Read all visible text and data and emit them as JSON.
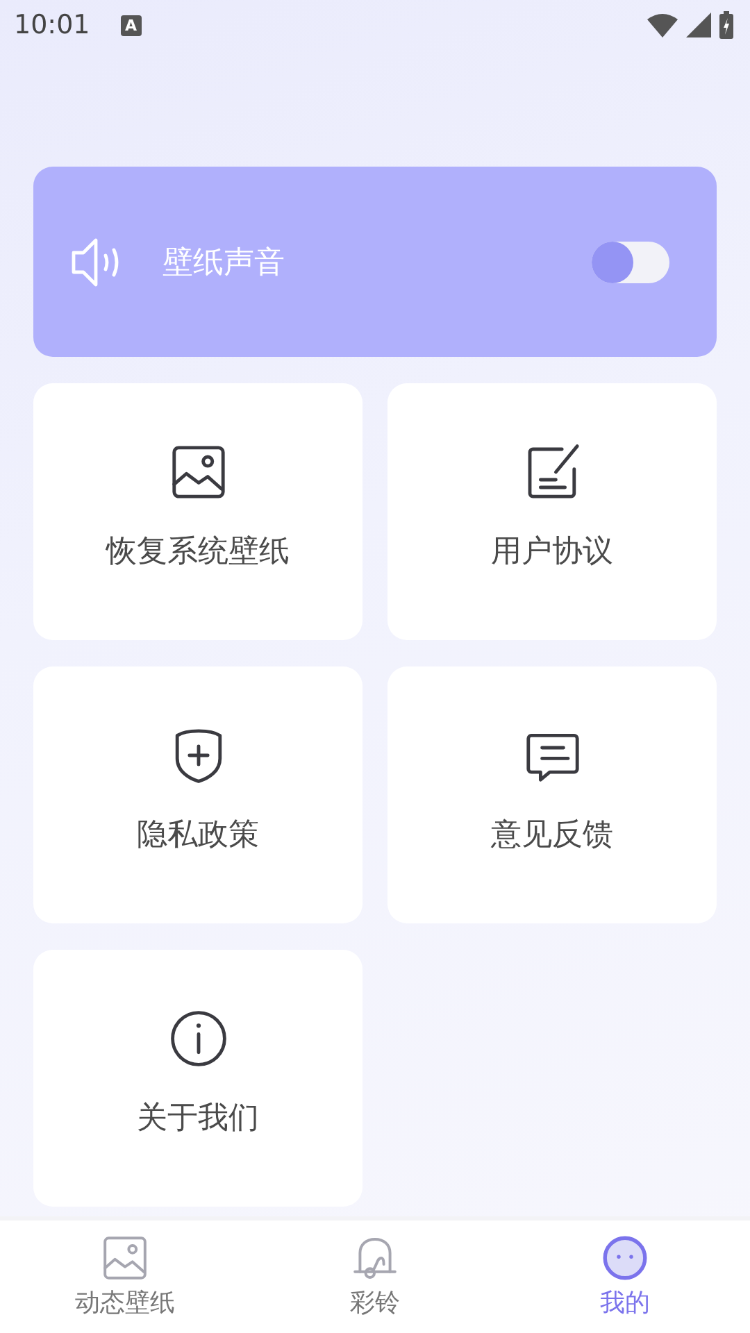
{
  "status_bar": {
    "time": "10:01",
    "app_icon_letter": "A"
  },
  "sound_card": {
    "label": "壁纸声音",
    "on": false
  },
  "menu": [
    {
      "kind": "image",
      "label": "恢复系统壁纸"
    },
    {
      "kind": "edit",
      "label": "用户协议"
    },
    {
      "kind": "shield",
      "label": "隐私政策"
    },
    {
      "kind": "chat",
      "label": "意见反馈"
    },
    {
      "kind": "info",
      "label": "关于我们"
    }
  ],
  "bottom_nav": [
    {
      "kind": "image",
      "label": "动态壁纸",
      "selected": false
    },
    {
      "kind": "bell",
      "label": "彩铃",
      "selected": false
    },
    {
      "kind": "face",
      "label": "我的",
      "selected": true
    }
  ]
}
